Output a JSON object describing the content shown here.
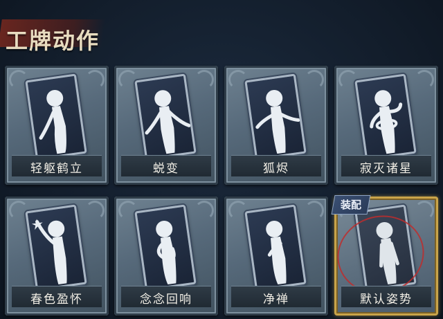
{
  "header": {
    "title": "工牌动作"
  },
  "cards": [
    {
      "label": "轻躯鹤立",
      "equipped": false,
      "pose": "pose-crane"
    },
    {
      "label": "蜕变",
      "equipped": false,
      "pose": "pose-arms-out"
    },
    {
      "label": "狐烬",
      "equipped": false,
      "pose": "pose-fox"
    },
    {
      "label": "寂灭诸星",
      "equipped": false,
      "pose": "pose-stars"
    },
    {
      "label": "春色盈怀",
      "equipped": false,
      "pose": "pose-spring"
    },
    {
      "label": "念念回响",
      "equipped": false,
      "pose": "pose-echo"
    },
    {
      "label": "净禅",
      "equipped": false,
      "pose": "pose-zen"
    },
    {
      "label": "默认姿势",
      "equipped": true,
      "pose": "pose-default",
      "badge": "装配"
    }
  ]
}
